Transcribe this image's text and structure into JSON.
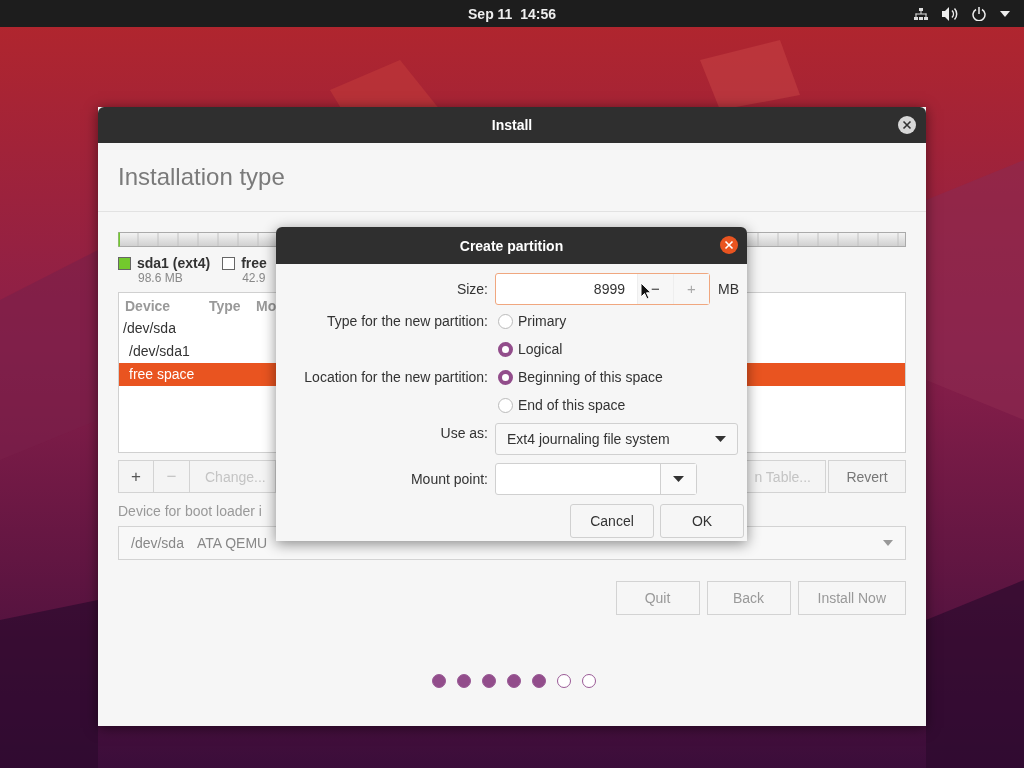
{
  "top_bar": {
    "clock": "Sep 11  14:56"
  },
  "window": {
    "title": "Install",
    "heading": "Installation type",
    "legend": [
      {
        "name": "sda1 (ext4)",
        "size": "98.6 MB",
        "color": "#73c92d"
      },
      {
        "name": "free",
        "size": "42.9",
        "color": "#ffffff"
      }
    ],
    "partition_table": {
      "columns": [
        "Device",
        "Type",
        "Mo"
      ],
      "rows": [
        {
          "device": "/dev/sda",
          "selected": false,
          "children": [
            {
              "device": "/dev/sda1",
              "selected": false
            },
            {
              "device": "free space",
              "selected": true
            }
          ]
        }
      ]
    },
    "toolbar": [
      {
        "label": "+",
        "disabled": false
      },
      {
        "label": "−",
        "disabled": true
      },
      {
        "label": "Change...",
        "disabled": true
      },
      {
        "label": "n Table...",
        "disabled": true
      },
      {
        "label": "Revert",
        "disabled": false
      }
    ],
    "boot_loader": {
      "label": "Device for boot loader i",
      "device": "/dev/sda",
      "description": "ATA QEMU"
    },
    "buttons": [
      {
        "label": "Quit"
      },
      {
        "label": "Back"
      },
      {
        "label": "Install Now"
      }
    ],
    "progress_dots": [
      {
        "done": true
      },
      {
        "done": true
      },
      {
        "done": true
      },
      {
        "done": true
      },
      {
        "done": true
      },
      {
        "done": false
      },
      {
        "done": false
      }
    ]
  },
  "dialog": {
    "title": "Create partition",
    "size": {
      "label": "Size:",
      "value": "8999",
      "minus": {
        "label": "−",
        "disabled": false
      },
      "plus": {
        "label": "+",
        "disabled": true
      },
      "unit": "MB"
    },
    "type": {
      "label": "Type for the new partition:",
      "options": [
        {
          "label": "Primary",
          "selected": false
        },
        {
          "label": "Logical",
          "selected": true
        }
      ]
    },
    "location": {
      "label": "Location for the new partition:",
      "options": [
        {
          "label": "Beginning of this space",
          "selected": true
        },
        {
          "label": "End of this space",
          "selected": false
        }
      ]
    },
    "use_as": {
      "label": "Use as:",
      "value": "Ext4 journaling file system"
    },
    "mount_point": {
      "label": "Mount point:"
    },
    "buttons": [
      {
        "label": "Cancel"
      },
      {
        "label": "OK"
      }
    ]
  }
}
